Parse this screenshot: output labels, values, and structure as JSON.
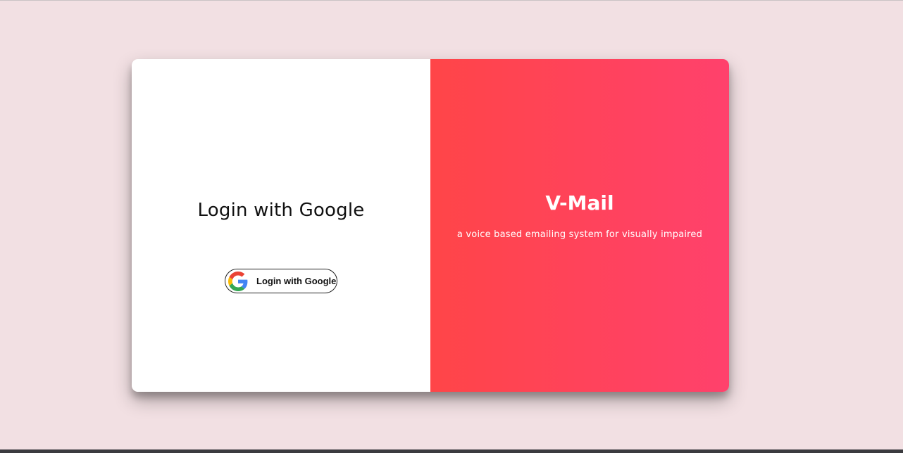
{
  "left": {
    "title": "Login with Google",
    "button": {
      "label": "Login with Google",
      "icon": "google-logo-icon"
    }
  },
  "right": {
    "title": "V-Mail",
    "subtitle": "a voice based emailing system for visually impaired"
  },
  "colors": {
    "background": "#f2e0e3",
    "gradient_start": "#ff4548",
    "gradient_end": "#ff416c"
  }
}
